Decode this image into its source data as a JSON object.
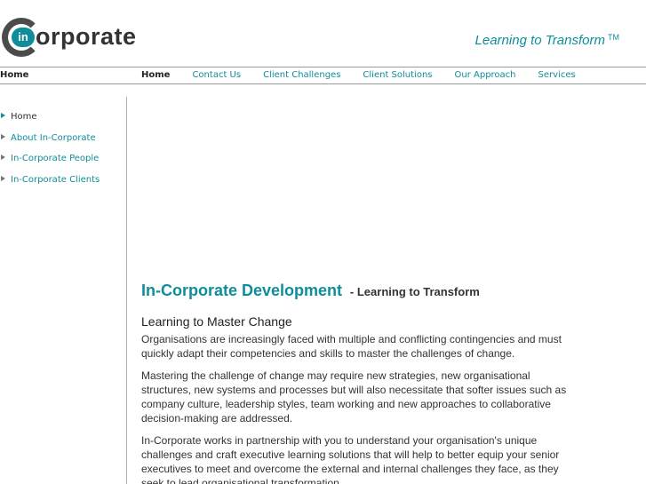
{
  "brand": {
    "logo_badge": "in",
    "logo_word": "orporate",
    "tagline": "Learning to Transform",
    "tagline_mark": "TM"
  },
  "nav": {
    "current_section": "Home",
    "links": [
      {
        "label": "Home",
        "active": true
      },
      {
        "label": "Contact Us"
      },
      {
        "label": "Client Challenges"
      },
      {
        "label": "Client Solutions"
      },
      {
        "label": "Our Approach"
      },
      {
        "label": "Services"
      }
    ]
  },
  "sidebar": {
    "items": [
      {
        "label": "Home",
        "icon": "triangle-right-icon"
      },
      {
        "label": "About In-Corporate",
        "icon": "triangle-right-icon"
      },
      {
        "label": "In-Corporate People",
        "icon": "triangle-right-icon"
      },
      {
        "label": "In-Corporate Clients",
        "icon": "triangle-right-icon"
      }
    ]
  },
  "main": {
    "title": "In-Corporate Development",
    "title_suffix": "- Learning to Transform",
    "subtitle": "Learning to Master Change",
    "paragraphs": [
      "Organisations are increasingly faced with multiple and conflicting contingencies and must quickly adapt their competencies and skills to master the challenges of change.",
      "Mastering the challenge of change may require new strategies, new organisational structures, new systems and processes but will also necessitate that softer issues such as company culture, leadership styles, team working and new approaches to collaborative decision-making are addressed.",
      "In-Corporate works in partnership with you to understand your organisation's unique challenges and craft executive learning solutions that will help to better equip your senior executives to meet and overcome the external and internal challenges they face, as they seek to lead organisational transformation."
    ]
  },
  "colors": {
    "accent": "#0f8d9a",
    "text": "#333333",
    "logo_dark": "#4b4b4b"
  }
}
